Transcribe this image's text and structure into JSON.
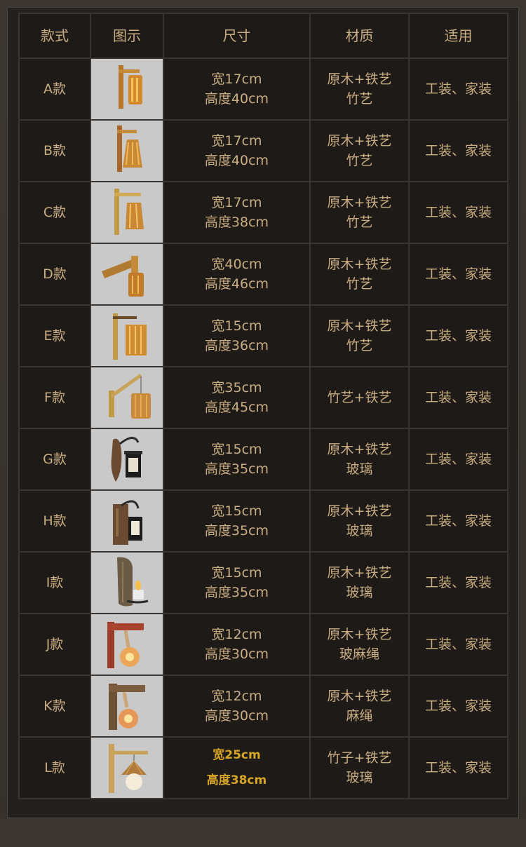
{
  "headers": [
    "款式",
    "图示",
    "尺寸",
    "材质",
    "适用"
  ],
  "rows": [
    {
      "style": "A款",
      "size": [
        "宽17cm",
        "高度40cm"
      ],
      "material": [
        "原木+铁艺",
        "竹艺"
      ],
      "use": "工装、家装",
      "icon": "bamboo-cylinder-lamp-icon"
    },
    {
      "style": "B款",
      "size": [
        "宽17cm",
        "高度40cm"
      ],
      "material": [
        "原木+铁艺",
        "竹艺"
      ],
      "use": "工装、家装",
      "icon": "bamboo-cone-lamp-icon"
    },
    {
      "style": "C款",
      "size": [
        "宽17cm",
        "高度38cm"
      ],
      "material": [
        "原木+铁艺",
        "竹艺"
      ],
      "use": "工装、家装",
      "icon": "bamboo-bucket-lamp-icon"
    },
    {
      "style": "D款",
      "size": [
        "宽40cm",
        "高度46cm"
      ],
      "material": [
        "原木+铁艺",
        "竹艺"
      ],
      "use": "工装、家装",
      "icon": "bamboo-barrel-lamp-icon"
    },
    {
      "style": "E款",
      "size": [
        "宽15cm",
        "高度36cm"
      ],
      "material": [
        "原木+铁艺",
        "竹艺"
      ],
      "use": "工装、家装",
      "icon": "bamboo-lantern-lamp-icon"
    },
    {
      "style": "F款",
      "size": [
        "宽35cm",
        "高度45cm"
      ],
      "material": [
        "竹艺+铁艺"
      ],
      "use": "工装、家装",
      "icon": "bamboo-hanging-lamp-icon"
    },
    {
      "style": "G款",
      "size": [
        "宽15cm",
        "高度35cm"
      ],
      "material": [
        "原木+铁艺",
        "玻璃"
      ],
      "use": "工装、家装",
      "icon": "wood-lantern-lamp-icon"
    },
    {
      "style": "H款",
      "size": [
        "宽15cm",
        "高度35cm"
      ],
      "material": [
        "原木+铁艺",
        "玻璃"
      ],
      "use": "工装、家装",
      "icon": "wood-plank-lantern-icon"
    },
    {
      "style": "I款",
      "size": [
        "宽15cm",
        "高度35cm"
      ],
      "material": [
        "原木+铁艺",
        "玻璃"
      ],
      "use": "工装、家装",
      "icon": "wood-candle-lamp-icon"
    },
    {
      "style": "J款",
      "size": [
        "宽12cm",
        "高度30cm"
      ],
      "material": [
        "原木+铁艺",
        "玻麻绳"
      ],
      "use": "工装、家装",
      "icon": "red-wood-rope-bulb-icon"
    },
    {
      "style": "K款",
      "size": [
        "宽12cm",
        "高度30cm"
      ],
      "material": [
        "原木+铁艺",
        "麻绳"
      ],
      "use": "工装、家装",
      "icon": "wood-rope-bulb-icon"
    },
    {
      "style": "L款",
      "size": [
        "宽25cm",
        "高度38cm"
      ],
      "material": [
        "竹子+铁艺",
        "玻璃"
      ],
      "use": "工装、家装",
      "icon": "bamboo-shade-globe-icon",
      "size_highlight": true
    }
  ],
  "colors": {
    "text": "#c9ad82",
    "highlight": "#d6a524",
    "cell": "#1e1a17",
    "grid": "#3a3530",
    "thumb_bg": "#c9c9c9"
  }
}
